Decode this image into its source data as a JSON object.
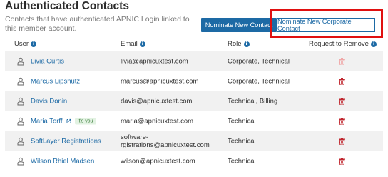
{
  "header": {
    "title": "Authenticated Contacts",
    "subtitle": "Contacts that have authenticated APNIC Login linked to this member account.",
    "nominate_button": "Nominate New Contact",
    "nominate_corporate_button": "Nominate New Corporate Contact"
  },
  "table": {
    "columns": {
      "user": "User",
      "email": "Email",
      "role": "Role",
      "remove": "Request to Remove"
    },
    "rows": [
      {
        "name": "Livia Curtis",
        "email": "livia@apnicuxtest.com",
        "role": "Corporate, Technical",
        "remove_enabled": false
      },
      {
        "name": "Marcus Lipshutz",
        "email": "marcus@apnicuxtest.com",
        "role": "Corporate, Technical",
        "remove_enabled": true
      },
      {
        "name": "Davis Donin",
        "email": "davis@apnicuxtest.com",
        "role": "Technical, Billing",
        "remove_enabled": true
      },
      {
        "name": "Maria Torff",
        "badge": "It's you",
        "email": "maria@apnicuxtest.com",
        "role": "Technical",
        "remove_enabled": true
      },
      {
        "name": "SoftLayer Registrations",
        "email_line1": "software-",
        "email_line2": "rgistrations@apnicuxtest.com",
        "role": "Technical",
        "remove_enabled": true
      },
      {
        "name": "Wilson Rhiel Madsen",
        "email": "wilson@apnicuxtest.com",
        "role": "Technical",
        "remove_enabled": true
      }
    ]
  },
  "colors": {
    "accent": "#1d6aa5",
    "trash_active": "#c0262e",
    "trash_disabled": "#f0a8a8",
    "highlight": "#e01010"
  }
}
